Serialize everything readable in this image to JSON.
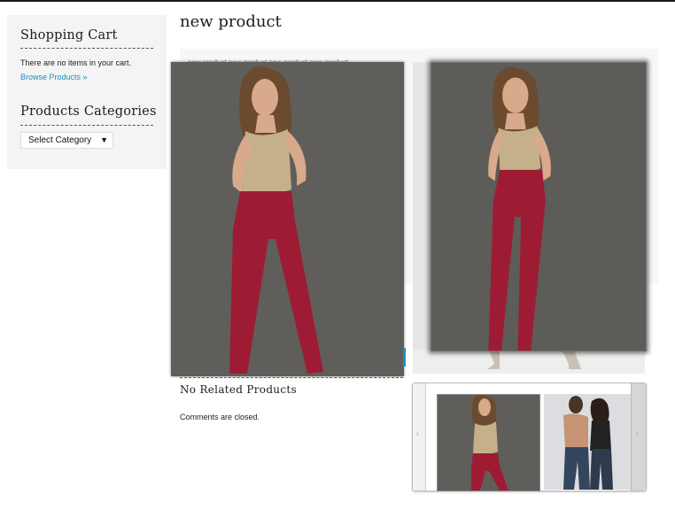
{
  "sidebar": {
    "cart_title": "Shopping Cart",
    "cart_empty": "There are no items in your cart.",
    "browse_link": "Browse Products »",
    "categories_title": "Products Categories",
    "select_category": "Select Category"
  },
  "main": {
    "title": "new product",
    "description": "new product new product new product new product",
    "related_heading": "No Related Products",
    "comments_closed": "Comments are closed."
  },
  "carousel": {
    "prev_arrow": "‹",
    "next_arrow": "›"
  },
  "colors": {
    "link": "#1a8fc4",
    "sidebar_bg": "#f4f4f4",
    "photo_bg": "#5f5e5a",
    "jeans": "#9e1b34"
  }
}
